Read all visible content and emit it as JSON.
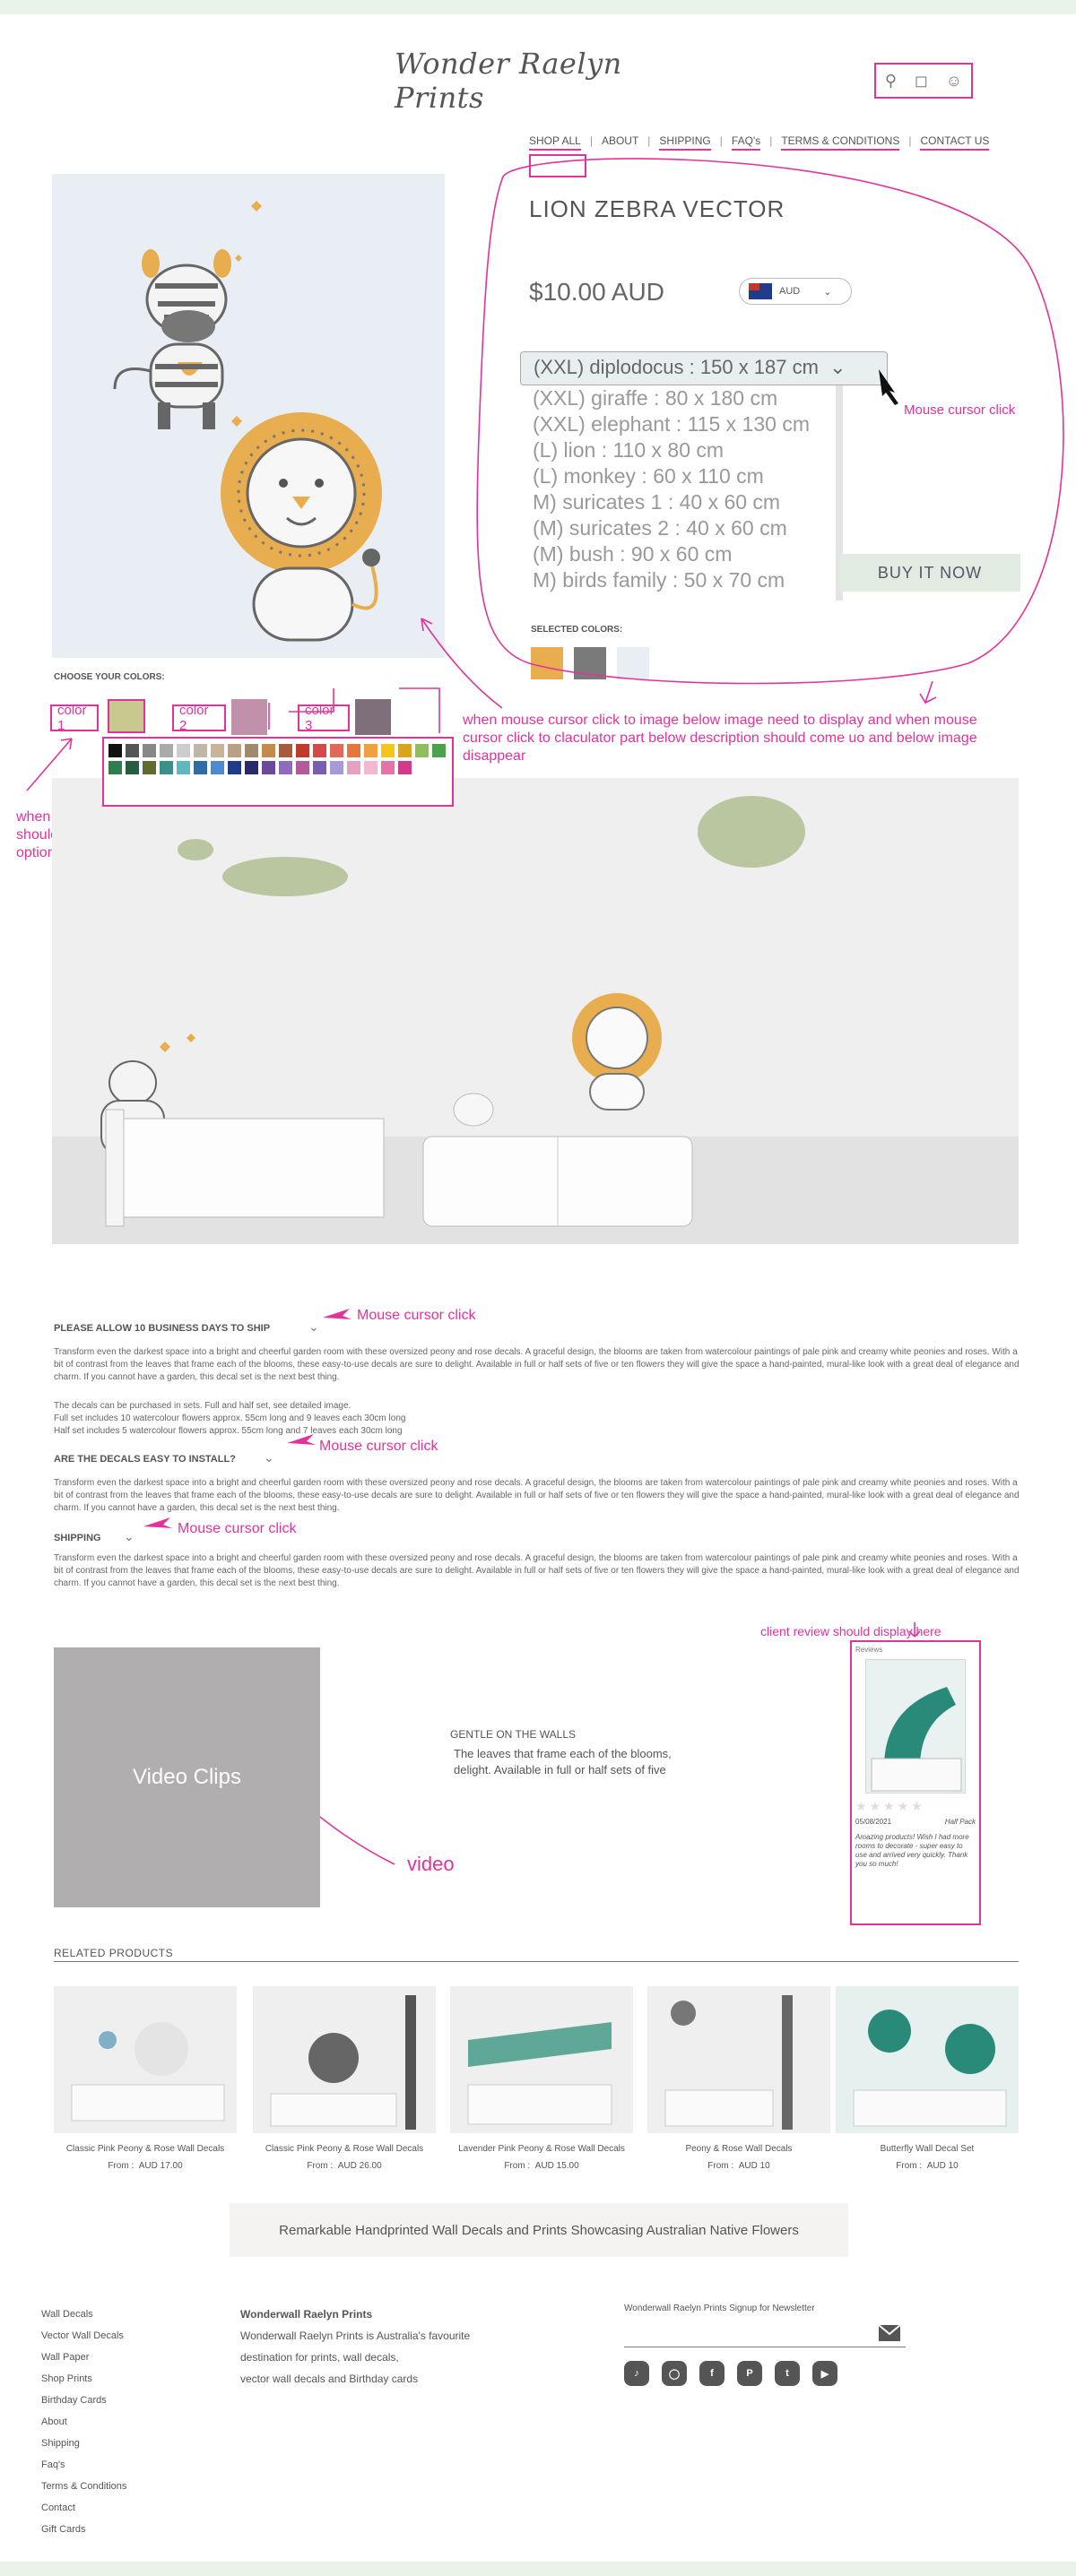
{
  "header": {
    "logo": "Wonder Raelyn Prints",
    "nav": [
      "SHOP ALL",
      "ABOUT",
      "SHIPPING",
      "FAQ's",
      "TERMS & CONDITIONS",
      "CONTACT US"
    ]
  },
  "product": {
    "title": "LION ZEBRA VECTOR",
    "price": "$10.00 AUD",
    "currency": "AUD",
    "selected_size": "(XXL) diplodocus : 150 x 187 cm",
    "size_options": [
      "(XXL) giraffe : 80 x 180 cm",
      "(XXL) elephant : 115 x 130 cm",
      "(L) lion : 110 x 80 cm",
      "(L) monkey : 60 x 110 cm",
      "M) suricates 1 : 40 x 60 cm",
      "(M) suricates 2 : 40 x 60 cm",
      "(M) bush : 90 x 60 cm",
      "M) birds family : 50 x 70 cm"
    ],
    "buy_label": "BUY IT NOW",
    "selected_colors_label": "SELECTED COLORS:",
    "selected_colors": [
      "#e8ad4f",
      "#7a7a7a",
      "#e9eef5"
    ]
  },
  "colors": {
    "choose_label": "CHOOSE YOUR COLORS:",
    "slots": [
      {
        "label": "color 1",
        "swatch": "#c7c98f"
      },
      {
        "label": "color 2",
        "swatch": "#c191ab"
      },
      {
        "label": "color 3",
        "swatch": "#7f6f7a"
      }
    ],
    "palette": [
      "#111111",
      "#555555",
      "#888888",
      "#aaaaaa",
      "#cccccc",
      "#bfb8a8",
      "#c9b49a",
      "#b8a184",
      "#a08a6a",
      "#c78a4e",
      "#a85a3a",
      "#c0392b",
      "#d44848",
      "#e06a5a",
      "#e6763a",
      "#f0a040",
      "#f5c518",
      "#d9a520",
      "#8fbf5a",
      "#4aa34a",
      "#2e7d4f",
      "#265c42",
      "#5f6b2f",
      "#3d8f8a",
      "#5fb8c0",
      "#2e6da4",
      "#4d8bd0",
      "#1f3b8a",
      "#2a2a6a",
      "#6b4a9a",
      "#8e6bbf",
      "#b35a9b",
      "#7a5fb0",
      "#a89ad8",
      "#e8a0c0",
      "#f2b8d0",
      "#e573a8",
      "#d43a8a"
    ]
  },
  "faq": [
    {
      "title": "PLEASE ALLOW 10 BUSINESS DAYS TO SHIP",
      "text": "Transform even the darkest space into a bright and cheerful garden room with these oversized peony and rose decals. A graceful design, the blooms are taken from watercolour paintings of pale pink and creamy white peonies and roses. With a bit of contrast from the leaves that frame each of the blooms, these easy-to-use decals are sure to delight. Available in full or half sets of five or ten flowers they will give the space a hand-painted, mural-like look with a great deal of elegance and charm. If you cannot have a garden, this decal set is the next best thing.",
      "extra": [
        "The decals can be purchased in sets. Full and half set, see detailed image.",
        "Full set includes 10 watercolour flowers approx. 55cm long and 9 leaves each 30cm long",
        "Half set includes 5 watercolour flowers approx. 55cm long and 7 leaves each 30cm long"
      ]
    },
    {
      "title": "ARE THE DECALS EASY TO INSTALL?",
      "text": "Transform even the darkest space into a bright and cheerful garden room with these oversized peony and rose decals. A graceful design, the blooms are taken from watercolour paintings of pale pink and creamy white peonies and roses. With a bit of contrast from the leaves that frame each of the blooms, these easy-to-use decals are sure to delight. Available in full or half sets of five or ten flowers they will give the space a hand-painted, mural-like look with a great deal of elegance and charm. If you cannot have a garden, this decal set is the next best thing."
    },
    {
      "title": "SHIPPING",
      "text": "Transform even the darkest space into a bright and cheerful garden room with these oversized peony and rose decals. A graceful design, the blooms are taken from watercolour paintings of pale pink and creamy white peonies and roses. With a bit of contrast from the leaves that frame each of the blooms, these easy-to-use decals are sure to delight. Available in full or half sets of five or ten flowers they will give the space a hand-painted, mural-like look with a great deal of elegance and charm. If you cannot have a garden, this decal set is the next best thing."
    }
  ],
  "video": {
    "label": "Video Clips"
  },
  "gentle": {
    "title": "GENTLE ON THE WALLS",
    "text": "The leaves that frame each of the blooms, delight. Available in full or half sets of five"
  },
  "review": {
    "title": "Reviews",
    "date": "05/08/2021",
    "product": "Half Pack",
    "text": "Amazing products! Wish I had more rooms to decorate - super easy to use and arrived very quickly. Thank you so much!"
  },
  "related": {
    "title": "RELATED PRODUCTS",
    "items": [
      {
        "name": "Classic Pink Peony & Rose Wall Decals",
        "price_prefix": "From :",
        "price": "AUD 17.00"
      },
      {
        "name": "Classic Pink Peony & Rose Wall Decals",
        "price_prefix": "From :",
        "price": "AUD 26.00"
      },
      {
        "name": "Lavender Pink Peony & Rose Wall Decals",
        "price_prefix": "From :",
        "price": "AUD 15.00"
      },
      {
        "name": "Peony & Rose Wall Decals",
        "price_prefix": "From :",
        "price": "AUD 10"
      },
      {
        "name": "Butterfly Wall Decal Set",
        "price_prefix": "From :",
        "price": "AUD 10"
      }
    ]
  },
  "banner": "Remarkable Handprinted Wall Decals and Prints Showcasing Australian Native Flowers",
  "footer": {
    "links": [
      "Wall Decals",
      "Vector Wall Decals",
      "Wall Paper",
      "Shop Prints",
      "Birthday Cards",
      "About",
      "Shipping",
      "Faq's",
      "Terms & Conditions",
      "Contact",
      "Gift Cards"
    ],
    "brand": "Wonderwall Raelyn Prints",
    "about": [
      "Wonderwall Raelyn Prints is Australia's favourite",
      "destination for prints, wall decals,",
      "vector wall decals and Birthday cards"
    ],
    "newsletter": "Wonderwall Raelyn Prints Signup for Newsletter",
    "social": [
      "tiktok",
      "instagram",
      "facebook",
      "pinterest",
      "twitter",
      "youtube"
    ]
  },
  "annotations": {
    "cursor_click_1": "Mouse cursor click",
    "image_note": "when mouse cursor click to image below image need to display and when mouse cursor click to claculator part below description should come uo and below image disappear",
    "color_note": "when click color should colour should displays for choose colour options",
    "cursor_click_2": "Mouse cursor click",
    "cursor_click_3": "Mouse cursor click",
    "cursor_click_4": "Mouse cursor click",
    "review_note": "client review should display here",
    "video_note": "video"
  }
}
